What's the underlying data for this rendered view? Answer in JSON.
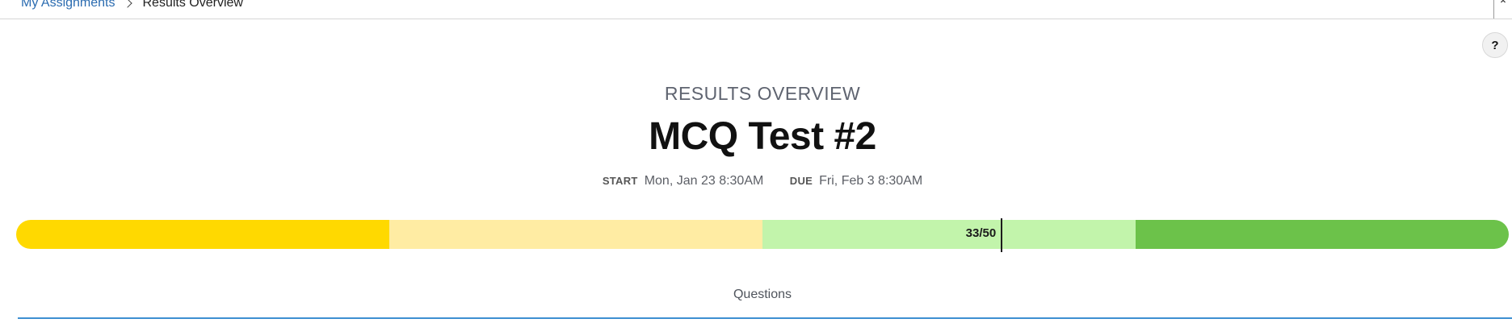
{
  "breadcrumb": {
    "parent": "My Assignments",
    "current": "Results Overview"
  },
  "help_label": "?",
  "header": {
    "overline": "RESULTS OVERVIEW",
    "title": "MCQ Test #2",
    "start_label": "START",
    "start_value": "Mon, Jan 23 8:30AM",
    "due_label": "DUE",
    "due_value": "Fri, Feb 3 8:30AM"
  },
  "score": {
    "text": "33/50",
    "earned": 33,
    "total": 50,
    "segments": [
      "#ffd900",
      "#ffeca3",
      "#c2f4ab",
      "#6cc24a"
    ]
  },
  "section": {
    "label": "Questions"
  },
  "colors": {
    "link": "#2a6bb0",
    "tab_underline": "#3d8fd1"
  }
}
